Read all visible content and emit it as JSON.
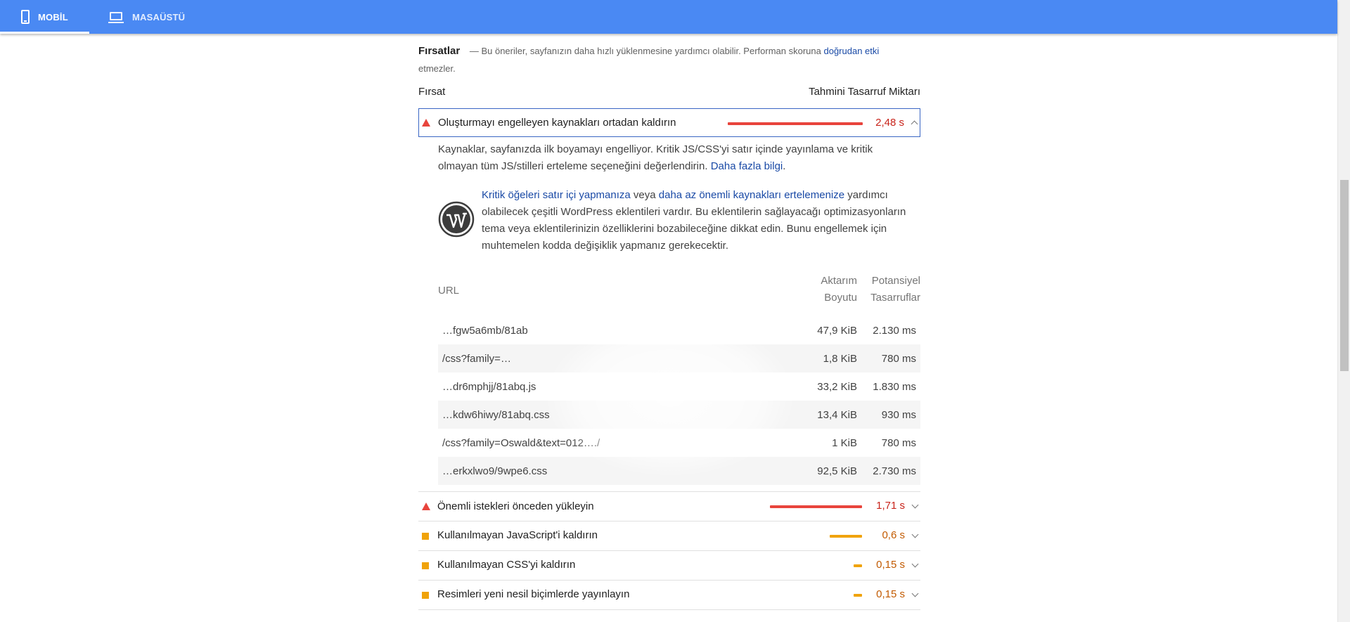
{
  "tabs": [
    {
      "label": "MOBİL",
      "icon": "phone-icon",
      "active": true
    },
    {
      "label": "MASAÜSTÜ",
      "icon": "laptop-icon",
      "active": false
    }
  ],
  "opportunities": {
    "title": "Fırsatlar",
    "intro_dash": "—",
    "intro_text": "Bu öneriler, sayfanızın daha hızlı yüklenmesine yardımcı olabilir. Performan skoruna",
    "intro_link": "doğrudan etki",
    "intro_tail": "etmezler.",
    "col_left": "Fırsat",
    "col_right": "Tahmini Tasarruf Miktarı"
  },
  "expanded_audit": {
    "title": "Oluşturmayı engelleyen kaynakları ortadan kaldırın",
    "value": "2,48 s",
    "severity": "fail",
    "bar_fraction": 1.0,
    "desc_text": "Kaynaklar, sayfanızda ilk boyamayı engelliyor. Kritik JS/CSS'yi satır içinde yayınlama ve kritik olmayan tüm JS/stilleri erteleme seçeneğini değerlendirin.",
    "desc_link": "Daha fazla bilgi",
    "desc_end": ".",
    "wp_link1": "Kritik öğeleri satır içi yapmanıza",
    "wp_mid": "veya",
    "wp_link2": "daha az önemli kaynakları ertelemenize",
    "wp_rest": "yardımcı olabilecek çeşitli WordPress eklentileri vardır. Bu eklentilerin sağlayacağı optimizasyonların tema veya eklentilerinizin özelliklerini bozabileceğine dikkat edin. Bunu engellemek için muhtemelen kodda değişiklik yapmanız gerekecektir.",
    "table": {
      "col_url": "URL",
      "col_size_1": "Aktarım",
      "col_size_2": "Boyutu",
      "col_save_1": "Potansiyel",
      "col_save_2": "Tasarruflar",
      "rows": [
        {
          "url": "…fgw5a6mb/81ab",
          "size": "47,9 KiB",
          "savings": "2.130 ms"
        },
        {
          "url": "/css?family=…",
          "size": "1,8 KiB",
          "savings": "780 ms"
        },
        {
          "url": "…dr6mphjj/81abq.js",
          "size": "33,2 KiB",
          "savings": "1.830 ms"
        },
        {
          "url": "…kdw6hiwy/81abq.css",
          "size": "13,4 KiB",
          "savings": "930 ms"
        },
        {
          "url": "/css?family=Oswald&text=012…./",
          "size": "1 KiB",
          "savings": "780 ms"
        },
        {
          "url": "…erkxlwo9/9wpe6.css",
          "size": "92,5 KiB",
          "savings": "2.730 ms"
        }
      ]
    }
  },
  "audits": [
    {
      "title": "Önemli istekleri önceden yükleyin",
      "value": "1,71 s",
      "severity": "fail",
      "bar_fraction": 0.69
    },
    {
      "title": "Kullanılmayan JavaScript'i kaldırın",
      "value": "0,6 s",
      "severity": "average",
      "bar_fraction": 0.24
    },
    {
      "title": "Kullanılmayan CSS'yi kaldırın",
      "value": "0,15 s",
      "severity": "average",
      "bar_fraction": 0.06
    },
    {
      "title": "Resimleri yeni nesil biçimlerde yayınlayın",
      "value": "0,15 s",
      "severity": "average",
      "bar_fraction": 0.06
    }
  ],
  "colors": {
    "topbar": "#4a89f3",
    "fail": "#e8443c",
    "average": "#f0a30a",
    "link": "#1a4aa6"
  }
}
